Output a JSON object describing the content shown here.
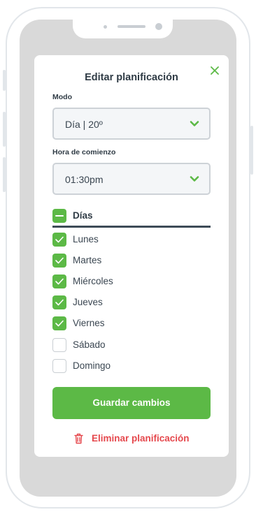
{
  "colors": {
    "accent": "#5cb946",
    "danger": "#e5484d",
    "text": "#2f3b45"
  },
  "modal": {
    "title": "Editar planificación",
    "close_icon": "close-icon",
    "mode": {
      "label": "Modo",
      "value": "Día | 20º"
    },
    "start_time": {
      "label": "Hora de comienzo",
      "value": "01:30pm"
    },
    "days": {
      "label": "Días",
      "header_state": "indeterminate",
      "items": [
        {
          "label": "Lunes",
          "checked": true
        },
        {
          "label": "Martes",
          "checked": true
        },
        {
          "label": "Miércoles",
          "checked": true
        },
        {
          "label": "Jueves",
          "checked": true
        },
        {
          "label": "Viernes",
          "checked": true
        },
        {
          "label": "Sábado",
          "checked": false
        },
        {
          "label": "Domingo",
          "checked": false
        }
      ]
    },
    "save_label": "Guardar cambios",
    "delete_label": "Eliminar planificación",
    "delete_icon": "trash-icon"
  }
}
